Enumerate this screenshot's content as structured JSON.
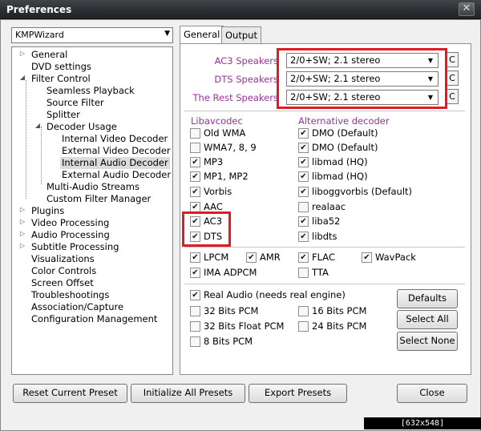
{
  "window": {
    "title": "Preferences",
    "close_glyph": "✕"
  },
  "preset": {
    "selected": "KMPWizard"
  },
  "tree": {
    "items": [
      "General",
      "DVD settings",
      "Filter Control",
      "Seamless Playback",
      "Source Filter",
      "Splitter",
      "Decoder Usage",
      "Internal Video Decoder",
      "External Video Decoder",
      "Internal Audio Decoder",
      "External Audio Decoder",
      "Multi-Audio Streams",
      "Custom Filter Manager",
      "Plugins",
      "Video Processing",
      "Audio Processing",
      "Subtitle Processing",
      "Visualizations",
      "Color Controls",
      "Screen Offset",
      "Troubleshootings",
      "Association/Capture",
      "Configuration Management"
    ],
    "selected": "Internal Audio Decoder"
  },
  "tabs": [
    "General",
    "Output"
  ],
  "speakers": [
    {
      "label": "AC3 Speakers",
      "value": "2/0+SW; 2.1 stereo",
      "btn": "C"
    },
    {
      "label": "DTS Speakers",
      "value": "2/0+SW; 2.1 stereo",
      "btn": "C"
    },
    {
      "label": "The Rest Speakers",
      "value": "2/0+SW; 2.1 stereo",
      "btn": "C"
    }
  ],
  "libav": {
    "header": "Libavcodec",
    "items": [
      {
        "label": "Old WMA",
        "checked": false
      },
      {
        "label": "WMA7, 8, 9",
        "checked": false
      },
      {
        "label": "MP3",
        "checked": true
      },
      {
        "label": "MP1, MP2",
        "checked": true
      },
      {
        "label": "Vorbis",
        "checked": true
      },
      {
        "label": "AAC",
        "checked": true
      },
      {
        "label": "AC3",
        "checked": true
      },
      {
        "label": "DTS",
        "checked": true
      }
    ]
  },
  "alt": {
    "header": "Alternative decoder",
    "items": [
      {
        "label": "DMO (Default)",
        "checked": true
      },
      {
        "label": "DMO (Default)",
        "checked": true
      },
      {
        "label": "libmad (HQ)",
        "checked": true
      },
      {
        "label": "libmad (HQ)",
        "checked": true
      },
      {
        "label": "liboggvorbis (Default)",
        "checked": true
      },
      {
        "label": "realaac",
        "checked": false
      },
      {
        "label": "liba52",
        "checked": true
      },
      {
        "label": "libdts",
        "checked": true
      }
    ]
  },
  "formats": [
    {
      "label": "LPCM",
      "checked": true
    },
    {
      "label": "AMR",
      "checked": true
    },
    {
      "label": "FLAC",
      "checked": true
    },
    {
      "label": "WavPack",
      "checked": true
    },
    {
      "label": "IMA ADPCM",
      "checked": true
    },
    {
      "label": "TTA",
      "checked": false
    }
  ],
  "realaudio": {
    "main": {
      "label": "Real Audio (needs real engine)",
      "checked": true
    },
    "items": [
      {
        "label": "32 Bits PCM",
        "checked": false
      },
      {
        "label": "16 Bits PCM",
        "checked": false
      },
      {
        "label": "32 Bits Float PCM",
        "checked": false
      },
      {
        "label": "24 Bits PCM",
        "checked": false
      },
      {
        "label": "8 Bits PCM",
        "checked": false
      }
    ]
  },
  "side_buttons": [
    "Defaults",
    "Select All",
    "Select None"
  ],
  "bottom_buttons": [
    "Reset Current Preset",
    "Initialize All Presets",
    "Export Presets",
    "Close"
  ],
  "watermark": "[632x548] http://upic.me/",
  "colors": {
    "accent": "#993399",
    "highlight": "#e01b24"
  }
}
